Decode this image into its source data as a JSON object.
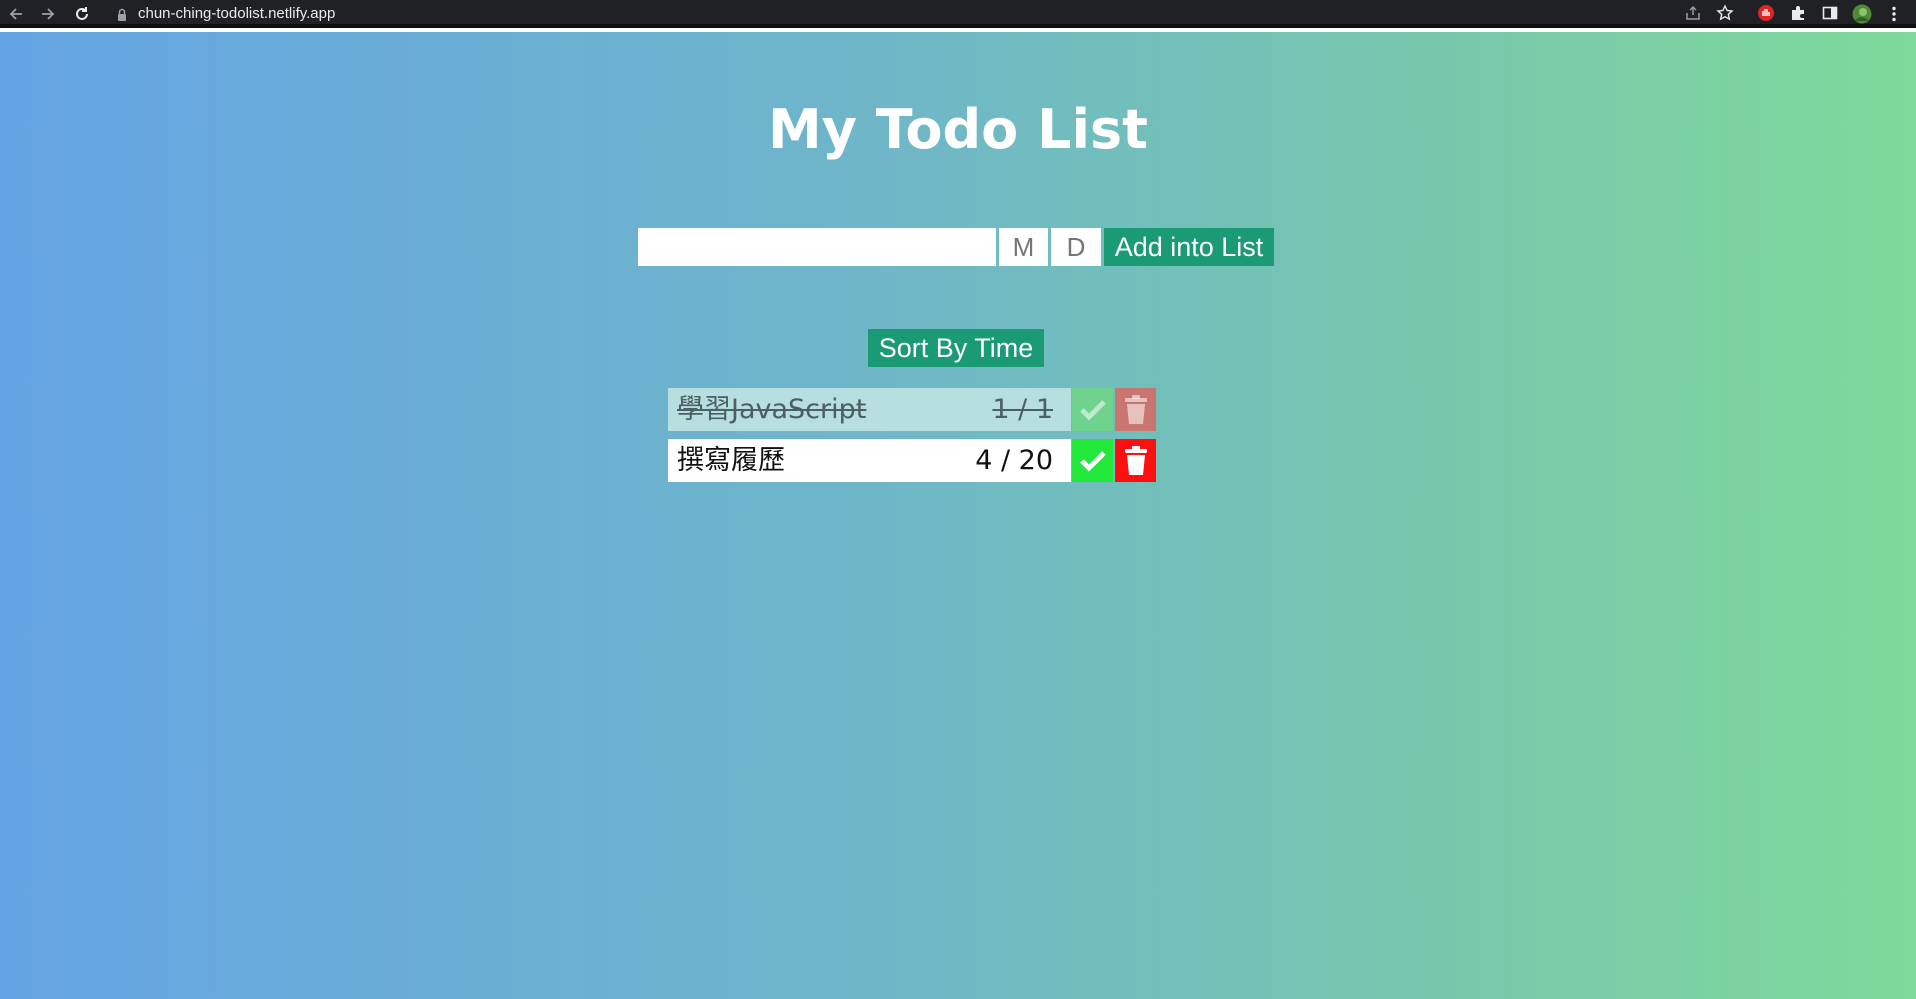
{
  "browser": {
    "url": "chun-ching-todolist.netlify.app",
    "icons": [
      "back-arrow-icon",
      "forward-arrow-icon",
      "reload-icon",
      "lock-icon",
      "share-icon",
      "star-icon",
      "extension-hand-icon",
      "puzzle-icon",
      "sidepanel-icon",
      "profile-avatar",
      "kebab-menu-icon"
    ]
  },
  "header": {
    "title": "My Todo List"
  },
  "form": {
    "todo_placeholder": "",
    "todo_value": "",
    "month_placeholder": "M",
    "day_placeholder": "D",
    "add_label": "Add into List"
  },
  "sort": {
    "label": "Sort By Time"
  },
  "todos": [
    {
      "text": "學習JavaScript",
      "time": "1 / 1",
      "done": true
    },
    {
      "text": "撰寫履歷",
      "time": "4 / 20",
      "done": false
    }
  ],
  "colors": {
    "button_green": "#1a9a75",
    "check_green": "#21e83a",
    "trash_red": "#ff1010",
    "gradient_left": "#65a4e3",
    "gradient_right": "#7fd99a"
  }
}
